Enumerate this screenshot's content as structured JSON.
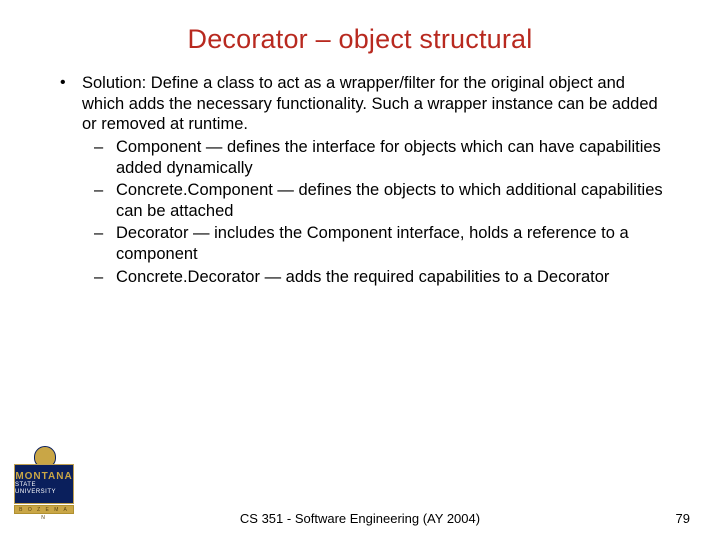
{
  "title": "Decorator – object structural",
  "bullet": {
    "lead": "Solution: Define a class to act as a wrapper/filter for the original object and which adds the necessary functionality. Such a wrapper instance can be added or removed at runtime.",
    "subs": [
      "Component — defines the interface for objects which can have capabilities added dynamically",
      "Concrete.Component — defines the objects to which additional capabilities can be attached",
      "Decorator — includes the Component interface, holds a reference to a component",
      "Concrete.Decorator — adds the required capabilities to a Decorator"
    ]
  },
  "footer": {
    "center": "CS 351 - Software Engineering (AY 2004)",
    "page": "79"
  },
  "logo": {
    "line1": "MONTANA",
    "line2": "STATE UNIVERSITY",
    "bar": "B O Z E M A N"
  }
}
